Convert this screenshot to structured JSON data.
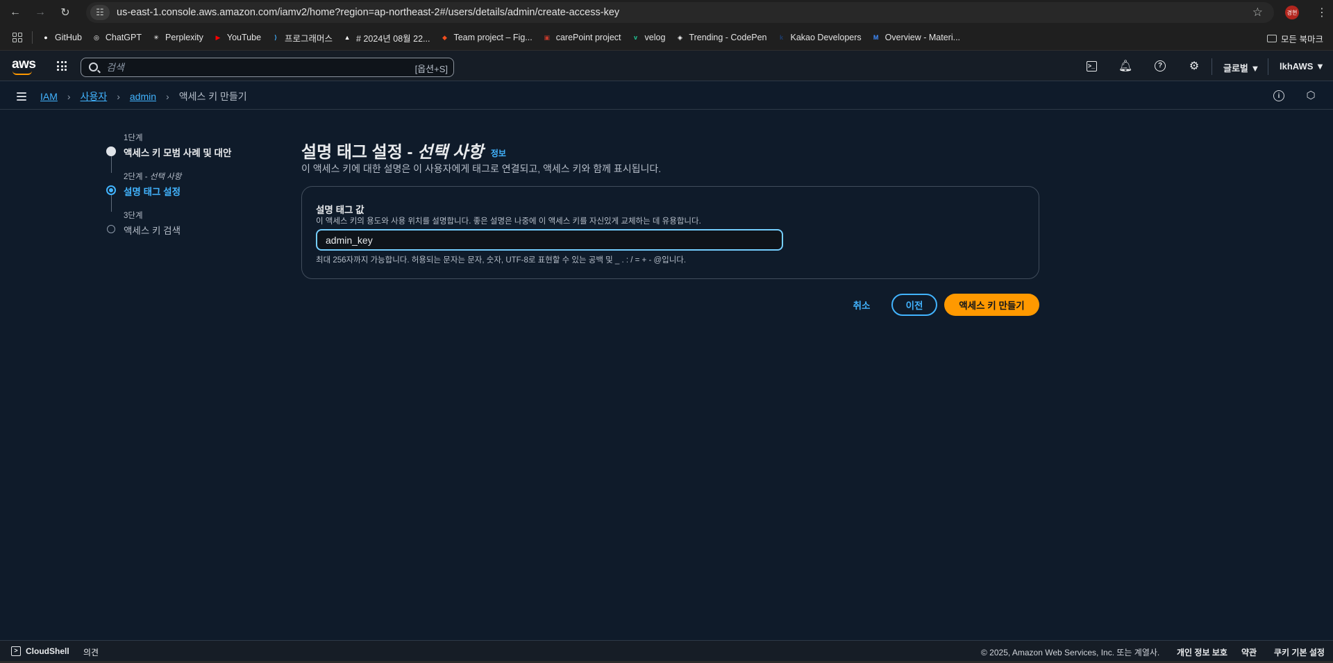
{
  "browser": {
    "url": "us-east-1.console.aws.amazon.com/iamv2/home?region=ap-northeast-2#/users/details/admin/create-access-key",
    "profile_initials": "경현",
    "bookmarks": [
      {
        "label": "GitHub",
        "icon": "github-icon",
        "color": "#ffffff"
      },
      {
        "label": "ChatGPT",
        "icon": "chatgpt-icon",
        "color": "#ffffff"
      },
      {
        "label": "Perplexity",
        "icon": "perplexity-icon",
        "color": "#ffffff"
      },
      {
        "label": "YouTube",
        "icon": "youtube-icon",
        "color": "#ff0000"
      },
      {
        "label": "프로그래머스",
        "icon": "programmers-icon",
        "color": "#3fa9f5"
      },
      {
        "label": "# 2024년 08월 22...",
        "icon": "notion-icon",
        "color": "#ffffff"
      },
      {
        "label": "Team project – Fig...",
        "icon": "figma-icon",
        "color": "#f24e1e"
      },
      {
        "label": "carePoint project",
        "icon": "carepoint-icon",
        "color": "#c0392b"
      },
      {
        "label": "velog",
        "icon": "velog-icon",
        "color": "#20c997"
      },
      {
        "label": "Trending - CodePen",
        "icon": "codepen-icon",
        "color": "#ffffff"
      },
      {
        "label": "Kakao Developers",
        "icon": "kakao-icon",
        "color": "#1d3d6e"
      },
      {
        "label": "Overview - Materi...",
        "icon": "mui-icon",
        "color": "#3f8cff"
      }
    ],
    "all_bookmarks": "모든 북마크"
  },
  "aws_header": {
    "logo": "aws",
    "search_placeholder": "검색",
    "search_shortcut": "[옵션+S]",
    "region": "글로벌 ▼",
    "account": "lkhAWS ▼"
  },
  "breadcrumb": {
    "items": [
      "IAM",
      "사용자",
      "admin"
    ],
    "current": "액세스 키 만들기"
  },
  "steps": [
    {
      "number": "1단계",
      "title": "액세스 키 모범 사례 및 대안",
      "state": "done"
    },
    {
      "number": "2단계 - ",
      "number_suffix": "선택 사항",
      "title": "설명 태그 설정",
      "state": "active"
    },
    {
      "number": "3단계",
      "title": "액세스 키 검색",
      "state": "pending"
    }
  ],
  "main": {
    "title": "설명 태그 설정 - ",
    "title_suffix": "선택 사항",
    "info_link": "정보",
    "description": "이 액세스 키에 대한 설명은 이 사용자에게 태그로 연결되고, 액세스 키와 함께 표시됩니다.",
    "field": {
      "label": "설명 태그 값",
      "description": "이 액세스 키의 용도와 사용 위치를 설명합니다. 좋은 설명은 나중에 이 액세스 키를 자신있게 교체하는 데 유용합니다.",
      "value": "admin_key",
      "hint": "최대 256자까지 가능합니다. 허용되는 문자는 문자, 숫자, UTF-8로 표현할 수 있는 공백 및 _ . : / = + - @입니다."
    },
    "buttons": {
      "cancel": "취소",
      "previous": "이전",
      "create": "액세스 키 만들기"
    }
  },
  "footer": {
    "cloudshell": "CloudShell",
    "feedback": "의견",
    "copyright": "© 2025, Amazon Web Services, Inc. 또는 계열사.",
    "privacy": "개인 정보 보호",
    "terms": "약관",
    "cookies": "쿠키 기본 설정"
  },
  "colors": {
    "accent": "#42b4ff",
    "primary_button": "#ff9900",
    "background": "#0f1b2a"
  }
}
